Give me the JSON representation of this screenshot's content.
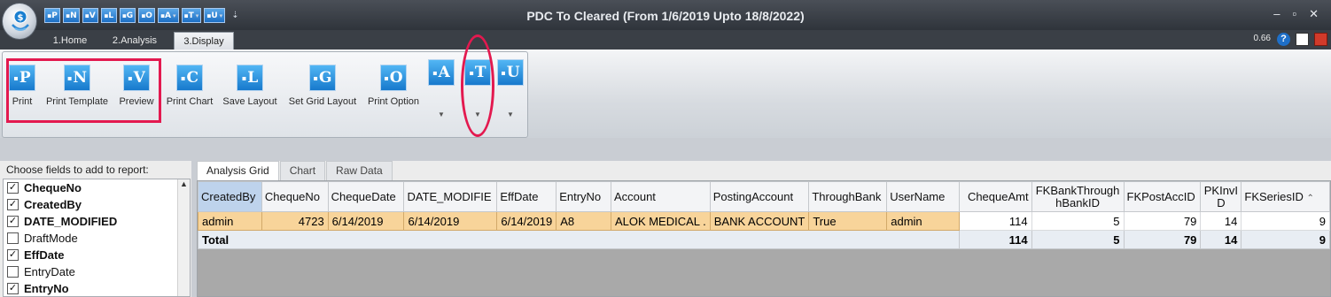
{
  "window": {
    "title": "PDC To Cleared (From 1/6/2019 Upto 18/8/2022)",
    "version": "0.66"
  },
  "qat": [
    "P",
    "N",
    "V",
    "L",
    "G",
    "O",
    "A",
    "T",
    "U"
  ],
  "ribbon_tabs": [
    "1.Home",
    "2.Analysis",
    "3.Display"
  ],
  "ribbon_buttons": [
    {
      "letter": "P",
      "label": "Print"
    },
    {
      "letter": "N",
      "label": "Print Template"
    },
    {
      "letter": "V",
      "label": "Preview"
    },
    {
      "letter": "C",
      "label": "Print Chart"
    },
    {
      "letter": "L",
      "label": "Save Layout"
    },
    {
      "letter": "G",
      "label": "Set Grid Layout"
    },
    {
      "letter": "O",
      "label": "Print Option"
    },
    {
      "letter": "A",
      "label": ""
    },
    {
      "letter": "T",
      "label": ""
    },
    {
      "letter": "U",
      "label": ""
    }
  ],
  "fields_panel": {
    "header": "Choose fields to add to report:",
    "items": [
      {
        "label": "ChequeNo",
        "checked": true
      },
      {
        "label": "CreatedBy",
        "checked": true
      },
      {
        "label": "DATE_MODIFIED",
        "checked": true
      },
      {
        "label": "DraftMode",
        "checked": false
      },
      {
        "label": "EffDate",
        "checked": true
      },
      {
        "label": "EntryDate",
        "checked": false
      },
      {
        "label": "EntryNo",
        "checked": true
      }
    ]
  },
  "grid_tabs": [
    "Analysis Grid",
    "Chart",
    "Raw Data"
  ],
  "grid": {
    "columns": [
      "CreatedBy",
      "ChequeNo",
      "ChequeDate",
      "DATE_MODIFIE",
      "EffDate",
      "EntryNo",
      "Account",
      "PostingAccount",
      "ThroughBank",
      "UserName",
      "ChequeAmt",
      "FKBankThroughBankID",
      "FKPostAccID",
      "PKInvID",
      "FKSeriesID"
    ],
    "column_headers_display": [
      "CreatedBy",
      "ChequeNo",
      "ChequeDate",
      "DATE_MODIFIE",
      "EffDate",
      "EntryNo",
      "Account",
      "PostingAccount",
      "ThroughBank",
      "UserName",
      "ChequeAmt",
      "FKBankThrough\nhBankID",
      "FKPostAccID",
      "PKInvI\nD",
      "FKSeriesID"
    ],
    "row": [
      "admin",
      "4723",
      "6/14/2019",
      "6/14/2019",
      "6/14/2019",
      "A8",
      "ALOK MEDICAL .",
      "BANK ACCOUNT",
      "True",
      "admin",
      "114",
      "5",
      "79",
      "14",
      "9"
    ],
    "total": {
      "label": "Total",
      "ChequeAmt": "114",
      "FKBankThroughBankID": "5",
      "FKPostAccID": "79",
      "PKInvID": "14",
      "FKSeriesID": "9"
    }
  }
}
